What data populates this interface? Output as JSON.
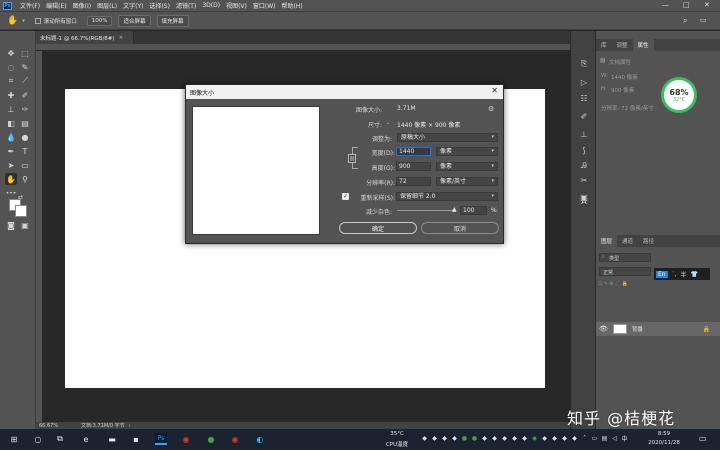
{
  "menubar": {
    "items": [
      "文件(F)",
      "编辑(E)",
      "图像(I)",
      "图层(L)",
      "文字(Y)",
      "选择(S)",
      "滤镜(T)",
      "3D(D)",
      "视图(V)",
      "窗口(W)",
      "帮助(H)"
    ],
    "minimize": "—",
    "maximize": "□",
    "close": "✕"
  },
  "options": {
    "scroll_all": "滚动所有窗口",
    "zoom_100": "100%",
    "fit_screen": "适合屏幕",
    "fill_screen": "填充屏幕"
  },
  "document": {
    "tab_title": "未标题-1 @ 66.7%(RGB/8#)",
    "close": "×",
    "zoom": "66.67%",
    "doc_info": "文档:3.71M/0 字节"
  },
  "dialog": {
    "title": "图像大小",
    "close": "✕",
    "image_size_label": "图像大小:",
    "image_size_value": "3.71M",
    "dimensions_label": "尺寸:",
    "dimensions_value": "1440 像素 × 900 像素",
    "fit_to_label": "调整为:",
    "fit_to_value": "原稿大小",
    "width_label": "宽度(D):",
    "width_value": "1440",
    "width_unit": "像素",
    "height_label": "高度(G):",
    "height_value": "900",
    "height_unit": "像素",
    "resolution_label": "分辨率(R):",
    "resolution_value": "72",
    "resolution_unit": "像素/英寸",
    "resample_label": "重新采样(S):",
    "resample_value": "保留细节 2.0",
    "reduce_noise_label": "减少杂色:",
    "reduce_noise_value": "100",
    "reduce_noise_unit": "%",
    "ok": "确定",
    "cancel": "取消"
  },
  "panels": {
    "top_tabs": [
      "库",
      "调整",
      "属性"
    ],
    "properties_title": "文档属性",
    "w_label": "W:",
    "w_value": "1440 像素",
    "h_label": "H:",
    "h_value": "900 像素",
    "resolution_text": "分辨率: 72 像素/英寸",
    "layer_tabs": [
      "图层",
      "通道",
      "路径"
    ],
    "layer_kind": "类型",
    "layer_mode": "正常",
    "layer_name": "背景"
  },
  "gauge": {
    "percent": "68%",
    "temp": "32°C"
  },
  "ime": {
    "lang": "En",
    "half": "半"
  },
  "watermark": "知乎 @桔梗花",
  "taskbar": {
    "cpu_temp": "35°C",
    "cpu_label": "CPU温度",
    "time": "8:59",
    "date": "2020/11/28"
  }
}
